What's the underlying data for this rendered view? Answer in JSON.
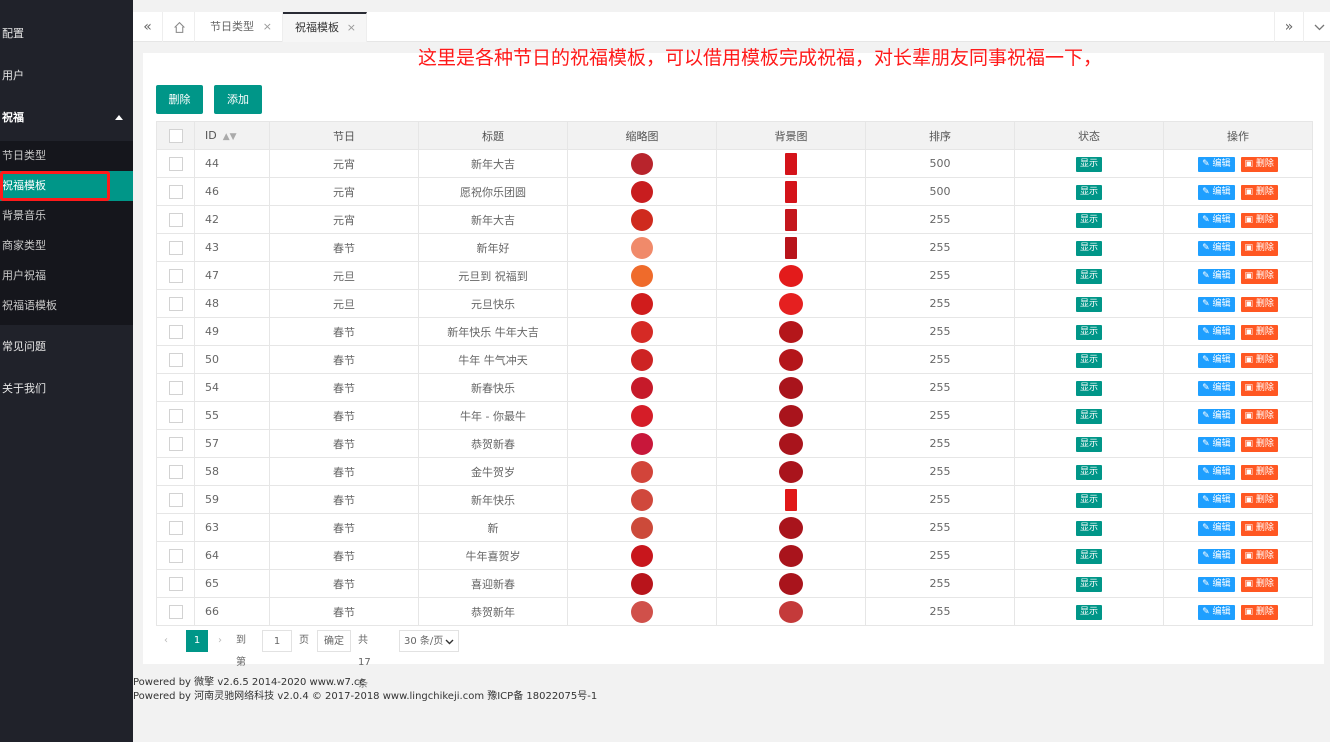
{
  "sidebar": {
    "items": [
      {
        "label": "配置"
      },
      {
        "label": "用户"
      },
      {
        "label": "祝福"
      },
      {
        "label": "常见问题"
      },
      {
        "label": "关于我们"
      }
    ],
    "subitems": [
      {
        "label": "节日类型"
      },
      {
        "label": "祝福模板"
      },
      {
        "label": "背景音乐"
      },
      {
        "label": "商家类型"
      },
      {
        "label": "用户祝福"
      },
      {
        "label": "祝福语模板"
      }
    ]
  },
  "tabs": [
    {
      "label": "节日类型"
    },
    {
      "label": "祝福模板"
    }
  ],
  "annotation": "这里是各种节日的祝福模板，可以借用模板完成祝福，对长辈朋友同事祝福一下，",
  "toolbar": {
    "delete_label": "删除",
    "add_label": "添加"
  },
  "table": {
    "headers": [
      "ID",
      "节日",
      "标题",
      "缩略图",
      "背景图",
      "排序",
      "状态",
      "操作"
    ],
    "rows": [
      {
        "id": "44",
        "festival": "元宵",
        "title": "新年大吉",
        "sort": "500",
        "thumb": "#b8242c",
        "bg": "#d4131a",
        "bgshape": "tall"
      },
      {
        "id": "46",
        "festival": "元宵",
        "title": "愿祝你乐团圆",
        "sort": "500",
        "thumb": "#c81d1f",
        "bg": "#d4131a",
        "bgshape": "tall"
      },
      {
        "id": "42",
        "festival": "元宵",
        "title": "新年大吉",
        "sort": "255",
        "thumb": "#cf2a1e",
        "bg": "#c4161d",
        "bgshape": "tall"
      },
      {
        "id": "43",
        "festival": "春节",
        "title": "新年好",
        "sort": "255",
        "thumb": "#f08a6a",
        "bg": "#b8141b",
        "bgshape": "tall"
      },
      {
        "id": "47",
        "festival": "元旦",
        "title": "元旦到 祝福到",
        "sort": "255",
        "thumb": "#ef6b2b",
        "bg": "#e31b1b",
        "bgshape": "round"
      },
      {
        "id": "48",
        "festival": "元旦",
        "title": "元旦快乐",
        "sort": "255",
        "thumb": "#d01c1c",
        "bg": "#e52020",
        "bgshape": "round"
      },
      {
        "id": "49",
        "festival": "春节",
        "title": "新年快乐 牛年大吉",
        "sort": "255",
        "thumb": "#d52a25",
        "bg": "#b4161a",
        "bgshape": "round"
      },
      {
        "id": "50",
        "festival": "春节",
        "title": "牛年 牛气冲天",
        "sort": "255",
        "thumb": "#cd2323",
        "bg": "#b4161a",
        "bgshape": "round"
      },
      {
        "id": "54",
        "festival": "春节",
        "title": "新春快乐",
        "sort": "255",
        "thumb": "#c61a2a",
        "bg": "#a9141c",
        "bgshape": "round"
      },
      {
        "id": "55",
        "festival": "春节",
        "title": "牛年 - 你最牛",
        "sort": "255",
        "thumb": "#d51d28",
        "bg": "#a9141c",
        "bgshape": "round"
      },
      {
        "id": "57",
        "festival": "春节",
        "title": "恭贺新春",
        "sort": "255",
        "thumb": "#c8173a",
        "bg": "#a9141c",
        "bgshape": "round"
      },
      {
        "id": "58",
        "festival": "春节",
        "title": "金牛贺岁",
        "sort": "255",
        "thumb": "#d2443a",
        "bg": "#a9141c",
        "bgshape": "round"
      },
      {
        "id": "59",
        "festival": "春节",
        "title": "新年快乐",
        "sort": "255",
        "thumb": "#d0483c",
        "bg": "#e01818",
        "bgshape": "tall"
      },
      {
        "id": "63",
        "festival": "春节",
        "title": "新",
        "sort": "255",
        "thumb": "#cc4a3a",
        "bg": "#a9141c",
        "bgshape": "round"
      },
      {
        "id": "64",
        "festival": "春节",
        "title": "牛年喜贺岁",
        "sort": "255",
        "thumb": "#c8161c",
        "bg": "#a9141c",
        "bgshape": "round"
      },
      {
        "id": "65",
        "festival": "春节",
        "title": "喜迎新春",
        "sort": "255",
        "thumb": "#b8141b",
        "bg": "#a9141c",
        "bgshape": "round"
      },
      {
        "id": "66",
        "festival": "春节",
        "title": "恭贺新年",
        "sort": "255",
        "thumb": "#d0504a",
        "bg": "#c43a3a",
        "bgshape": "round"
      }
    ],
    "status_label": "显示",
    "edit_label": "编辑",
    "delete_label": "删除"
  },
  "pager": {
    "current": "1",
    "goto_label": "到第",
    "goto_value": "1",
    "page_unit": "页",
    "confirm_label": "确定",
    "total": "共 17 条",
    "per_page": "30 条/页"
  },
  "footer": {
    "line1": "Powered by 微擎 v2.6.5 2014-2020 www.w7.cc",
    "line2": "Powered by 河南灵驰网络科技 v2.0.4 © 2017-2018 www.lingchikeji.com 豫ICP备 18022075号-1"
  },
  "colors": {
    "accent": "#009688",
    "sidebar": "#20222a",
    "edit": "#1e9fff",
    "danger": "#ff5722",
    "annotation": "#ff1a1a"
  }
}
